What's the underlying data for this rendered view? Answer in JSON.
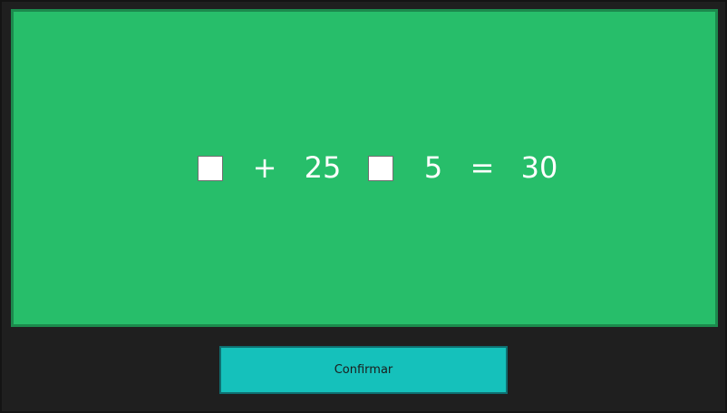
{
  "equation": {
    "slot_1": "",
    "term_1": "+",
    "term_2": "25",
    "slot_2": "",
    "term_3": "5",
    "term_4": "=",
    "term_5": "30"
  },
  "controls": {
    "confirm_label": "Confirmar"
  },
  "colors": {
    "board_background": "#27be6a",
    "board_border": "#1c8a4d",
    "window_background": "#1f1f1f",
    "button_background": "#15c1bb",
    "button_border": "#0f6f71",
    "text_light": "#ffffff",
    "text_dark": "#1b1b1b"
  }
}
